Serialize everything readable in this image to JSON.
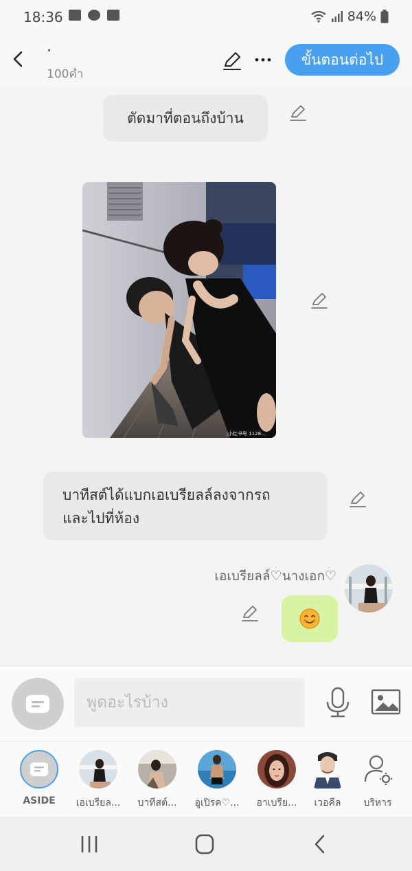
{
  "status": {
    "time": "18:36",
    "battery": "84%"
  },
  "header": {
    "title": "·",
    "word_count": "100คำ",
    "next_label": "ขั้นตอนต่อไป"
  },
  "messages": [
    {
      "type": "narration",
      "text": "ตัดมาที่ตอนถึงบ้าน"
    },
    {
      "type": "image"
    },
    {
      "type": "narration",
      "lines": [
        "บาทีสต์ได้แบกเอเบรียลล์ลงจากรถ",
        "และไปที่ห้อง"
      ]
    },
    {
      "type": "character",
      "name": "เอเบรียลล์♡นางเอก♡",
      "emoji": "😊"
    }
  ],
  "photo_watermark": "小红书号 1128...",
  "input": {
    "placeholder": "พูดอะไรบ้าง"
  },
  "characters": [
    {
      "label": "ASIDE"
    },
    {
      "label": "เอเบรียล..."
    },
    {
      "label": "บาทีสต์..."
    },
    {
      "label": "อูเปิรค♡..."
    },
    {
      "label": "อาเบรีย..."
    },
    {
      "label": "เวอคีล"
    },
    {
      "label": "บริหาร"
    }
  ],
  "colors": {
    "accent": "#4aa0f0",
    "emoji_bubble": "#d9f3a4",
    "narration_bubble": "#e9e9e9"
  }
}
